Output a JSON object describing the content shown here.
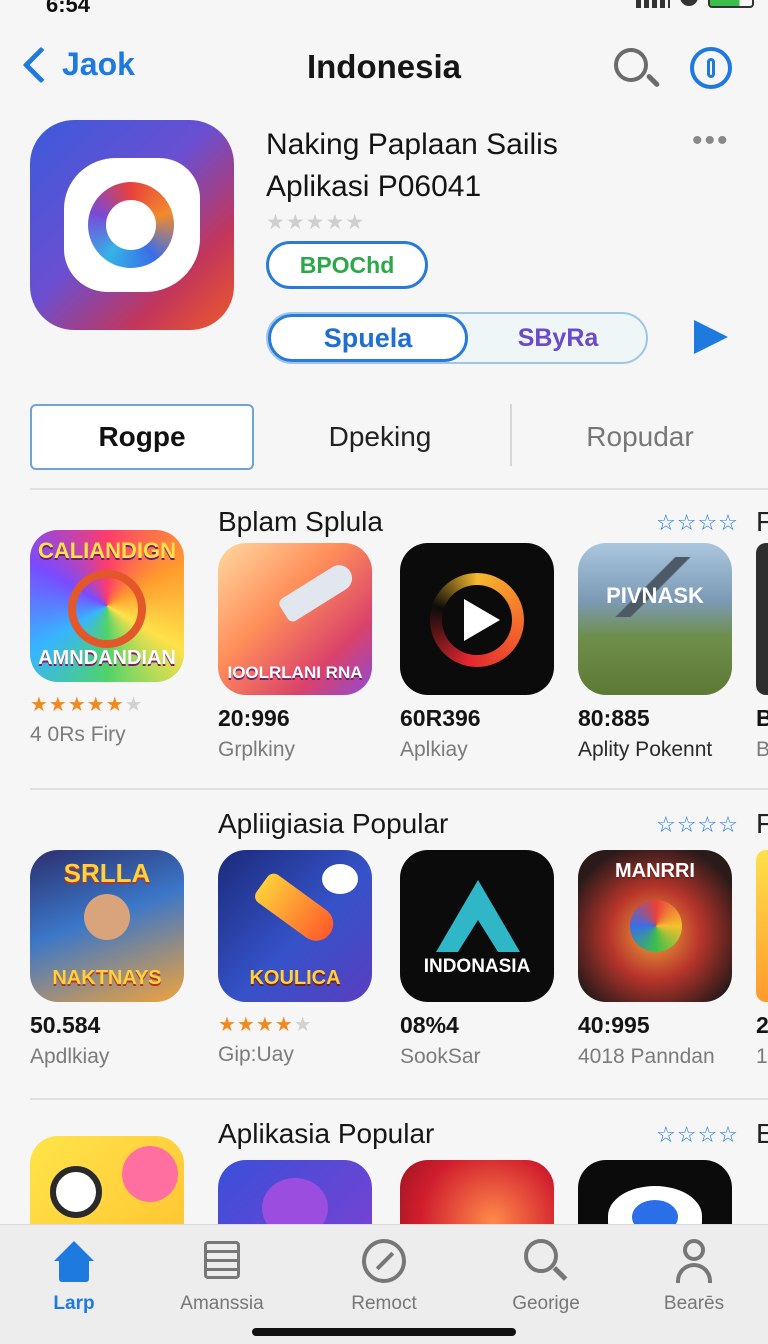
{
  "status": {
    "time": "6:54"
  },
  "nav": {
    "back_label": "Jaok",
    "title": "Indonesia"
  },
  "app": {
    "title_line1": "Naking Paplaan Sailis",
    "title_line2": "Aplikasi P06041",
    "stars": "★★★★★",
    "badge": "BPOChd",
    "segment_a": "Spuela",
    "segment_b": "SByRa",
    "more": "•••"
  },
  "tabs": [
    "Rogpe",
    "Dpeking",
    "Ropudar"
  ],
  "sections": [
    {
      "title": "Bplam Splula",
      "stars": "☆☆☆☆",
      "edge": "F",
      "items": [
        {
          "art": "AMNDANDIAN",
          "line1": "★★★★★",
          "line2": "4 0Rs Firy",
          "rating": 4.5
        },
        {
          "art": "IOOLRLANI RNA",
          "line1": "20:996",
          "line2": "Grplkiny"
        },
        {
          "art": "",
          "line1": "60R396",
          "line2": "Aplkiay"
        },
        {
          "art": "PIVNASK",
          "line1": "80:885",
          "line2": "Aplity Pokennt"
        }
      ],
      "peek": {
        "line1": "B",
        "line2": "B"
      }
    },
    {
      "title": "Apliigiasia Popular",
      "stars": "☆☆☆☆",
      "edge": "F",
      "items": [
        {
          "art": "NAKTNAYS",
          "line1": "50.584",
          "line2": "Apdlkiay"
        },
        {
          "art": "KOULICA",
          "line1": "★★★★★",
          "line2": "Gip:Uay",
          "rating": 4
        },
        {
          "art": "INDONASIA",
          "line1": "08%4",
          "line2": "SookSar"
        },
        {
          "art": "MANRRI",
          "line1": "40:995",
          "line2": "4018 Panndan"
        }
      ],
      "peek": {
        "line1": "2",
        "line2": "1"
      }
    },
    {
      "title": "Aplikasia Popular",
      "stars": "☆☆☆☆",
      "edge": "E"
    }
  ],
  "tabbar": [
    {
      "label": "Larp",
      "icon": "home-icon",
      "active": true
    },
    {
      "label": "Amanssia",
      "icon": "list-icon",
      "active": false
    },
    {
      "label": "Remoct",
      "icon": "compass-icon",
      "active": false
    },
    {
      "label": "Georige",
      "icon": "search-icon",
      "active": false
    },
    {
      "label": "Bearēs",
      "icon": "person-icon",
      "active": false
    }
  ],
  "colors": {
    "accent": "#1f7ae0",
    "badge_text": "#2ca84a",
    "star_orange": "#f08a1c"
  }
}
